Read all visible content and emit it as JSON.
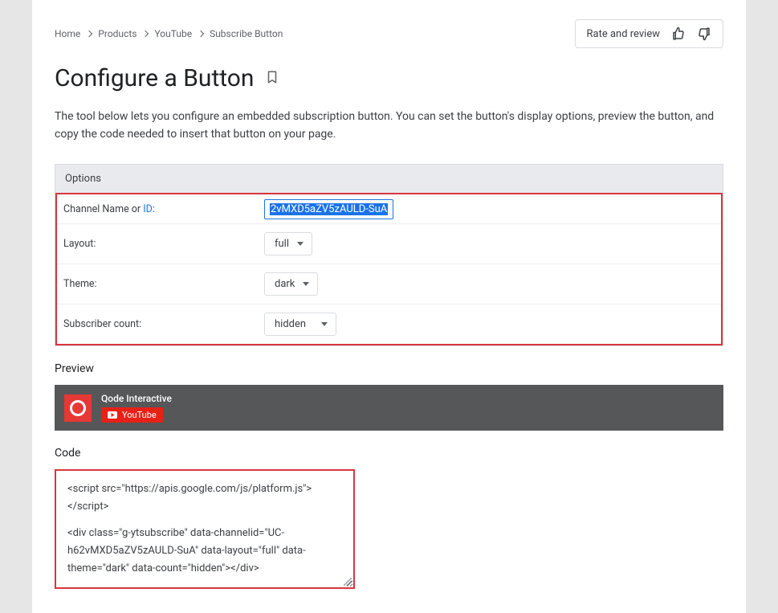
{
  "breadcrumb": [
    "Home",
    "Products",
    "YouTube",
    "Subscribe Button"
  ],
  "rate": {
    "label": "Rate and review"
  },
  "title": "Configure a Button",
  "intro": "The tool below lets you configure an embedded subscription button. You can set the button's display options, preview the button, and copy the code needed to insert that button on your page.",
  "options": {
    "heading": "Options",
    "channel_label_prefix": "Channel Name or ",
    "channel_label_link": "ID",
    "channel_label_suffix": ":",
    "channel_value": "2vMXD5aZV5zAULD-SuA",
    "layout_label": "Layout:",
    "layout_value": "full",
    "theme_label": "Theme:",
    "theme_value": "dark",
    "subcount_label": "Subscriber count:",
    "subcount_value": "hidden"
  },
  "preview": {
    "heading": "Preview",
    "channel_name": "Qode Interactive",
    "button_label": "YouTube"
  },
  "code": {
    "heading": "Code",
    "line1": "<script src=\"https://apis.google.com/js/platform.js\"></script>",
    "line2": "<div class=\"g-ytsubscribe\" data-channelid=\"UC-h62vMXD5aZV5zAULD-SuA\" data-layout=\"full\" data-theme=\"dark\" data-count=\"hidden\"></div>"
  },
  "colors": {
    "accent_red": "#d9363e",
    "link_blue": "#1a73e8",
    "yt_red": "#e62117"
  }
}
